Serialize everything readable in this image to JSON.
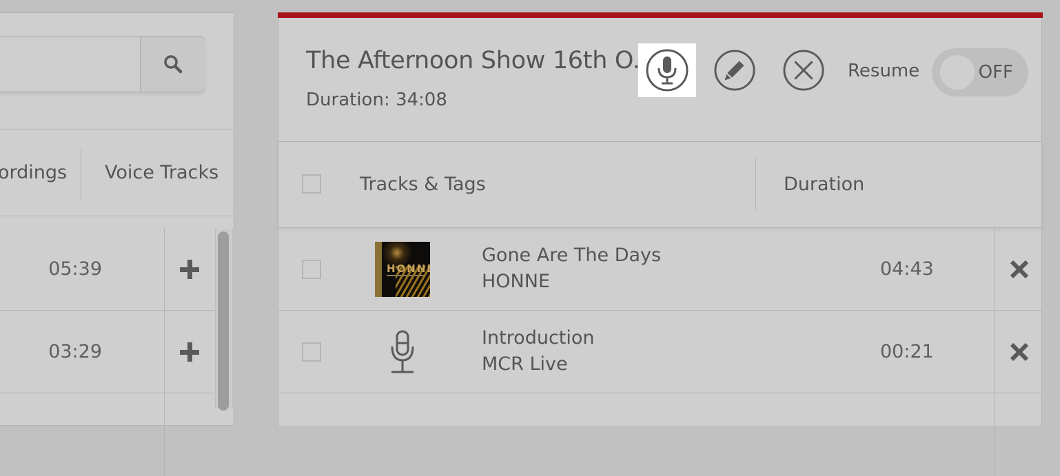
{
  "library": {
    "search": {
      "value": "",
      "placeholder": "",
      "button_icon": "search-icon"
    },
    "tabs": [
      {
        "label": "Recordings"
      },
      {
        "label": "Voice Tracks"
      }
    ],
    "rows": [
      {
        "duration": "05:39",
        "action_icon": "plus-icon"
      },
      {
        "duration": "03:29",
        "action_icon": "plus-icon"
      }
    ]
  },
  "show": {
    "title": "The Afternoon Show 16th O...",
    "duration_label": "Duration:",
    "duration_value": "34:08",
    "actions": [
      {
        "name": "record-voice-track",
        "icon": "microphone-icon",
        "active": true
      },
      {
        "name": "edit",
        "icon": "pencil-icon"
      },
      {
        "name": "close",
        "icon": "close-circle-icon"
      }
    ],
    "resume": {
      "label": "Resume",
      "state": "OFF"
    },
    "accent_color": "#a8131a"
  },
  "playlist": {
    "columns": [
      {
        "label": "Tracks & Tags"
      },
      {
        "label": "Duration"
      }
    ],
    "items": [
      {
        "title": "Gone Are The Days",
        "artist": "HONNE",
        "duration": "04:43",
        "thumbnail": "album-art",
        "art_text": "HONNE"
      },
      {
        "title": "Introduction",
        "artist": "MCR Live",
        "duration": "00:21",
        "thumbnail": "microphone-icon"
      }
    ]
  }
}
